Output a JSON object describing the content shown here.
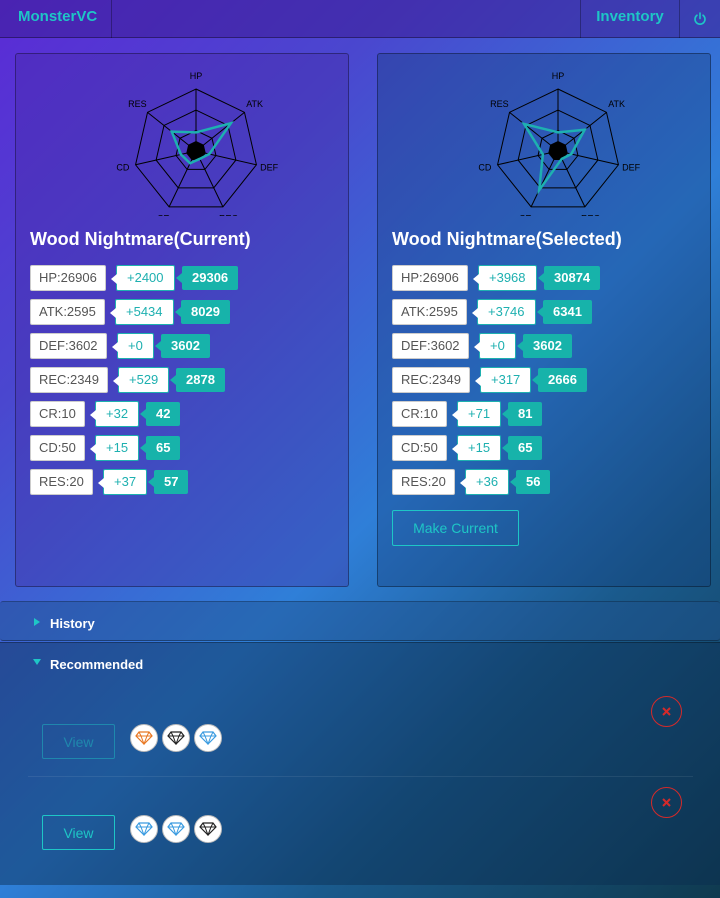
{
  "nav": {
    "brand": "MonsterVC",
    "inventory": "Inventory",
    "power_icon": "power-icon"
  },
  "radar_axes": [
    "HP",
    "ATK",
    "DEF",
    "REC",
    "CR",
    "CD",
    "RES"
  ],
  "current": {
    "title": "Wood Nightmare(Current)",
    "stats": [
      {
        "base": "HP:26906",
        "bonus": "+2400",
        "total": "29306"
      },
      {
        "base": "ATK:2595",
        "bonus": "+5434",
        "total": "8029"
      },
      {
        "base": "DEF:3602",
        "bonus": "+0",
        "total": "3602"
      },
      {
        "base": "REC:2349",
        "bonus": "+529",
        "total": "2878"
      },
      {
        "base": "CR:10",
        "bonus": "+32",
        "total": "42"
      },
      {
        "base": "CD:50",
        "bonus": "+15",
        "total": "65"
      },
      {
        "base": "RES:20",
        "bonus": "+37",
        "total": "57"
      }
    ]
  },
  "selected": {
    "title": "Wood Nightmare(Selected)",
    "stats": [
      {
        "base": "HP:26906",
        "bonus": "+3968",
        "total": "30874"
      },
      {
        "base": "ATK:2595",
        "bonus": "+3746",
        "total": "6341"
      },
      {
        "base": "DEF:3602",
        "bonus": "+0",
        "total": "3602"
      },
      {
        "base": "REC:2349",
        "bonus": "+317",
        "total": "2666"
      },
      {
        "base": "CR:10",
        "bonus": "+71",
        "total": "81"
      },
      {
        "base": "CD:50",
        "bonus": "+15",
        "total": "65"
      },
      {
        "base": "RES:20",
        "bonus": "+36",
        "total": "56"
      }
    ],
    "make_current_label": "Make Current"
  },
  "history": {
    "label": "History",
    "expanded": false
  },
  "recommended": {
    "label": "Recommended",
    "expanded": true,
    "items": [
      {
        "view_label": "View",
        "gems": [
          "orange-gem-icon",
          "black-gem-icon",
          "blue-gem-icon"
        ]
      },
      {
        "view_label": "View",
        "gems": [
          "blue-gem-icon",
          "blue-gem-icon",
          "black-gem-icon"
        ]
      }
    ]
  },
  "colors": {
    "accent": "#1ec6c6",
    "total_badge": "#17b3aa",
    "danger": "#d42a2a",
    "gem_orange": "#e87722",
    "gem_blue": "#3a9be0",
    "gem_black": "#222222"
  }
}
